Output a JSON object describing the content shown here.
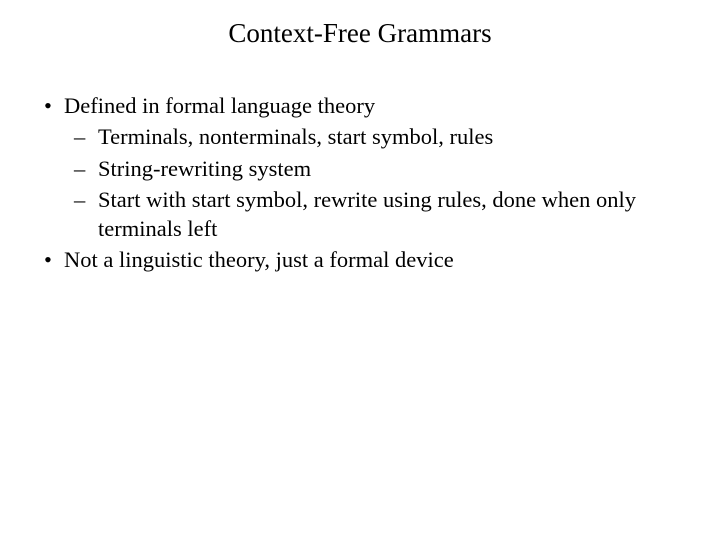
{
  "slide": {
    "title": "Context-Free Grammars",
    "bullets": [
      {
        "text": "Defined in formal language theory",
        "subs": [
          "Terminals, nonterminals, start symbol, rules",
          "String-rewriting system",
          "Start with start symbol, rewrite using rules, done when only terminals left"
        ]
      },
      {
        "text": "Not a linguistic theory, just a formal device",
        "subs": []
      }
    ]
  },
  "markers": {
    "bullet": "•",
    "dash": "–"
  }
}
